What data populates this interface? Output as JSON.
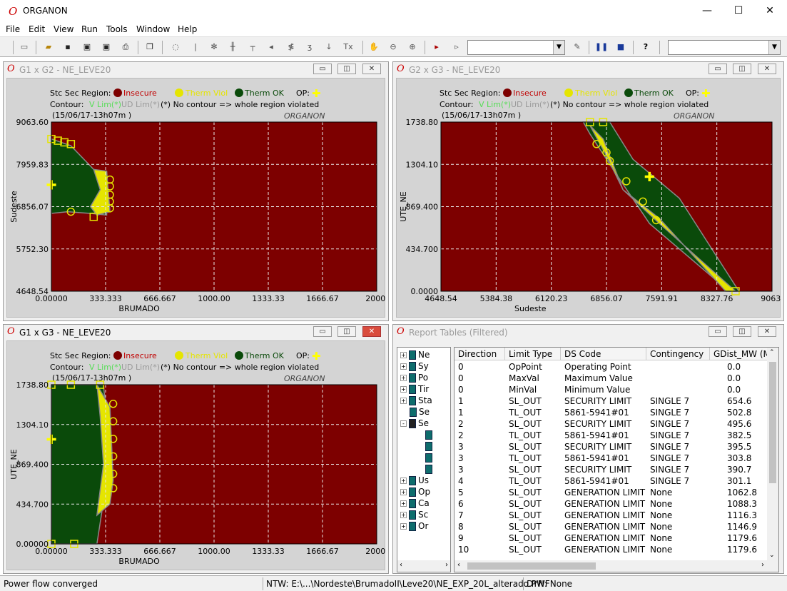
{
  "app": {
    "title": "ORGANON",
    "icon": "organon-logo-icon"
  },
  "window_controls": {
    "minimize": "—",
    "maximize": "☐",
    "close": "✕"
  },
  "menu": [
    "File",
    "Edit",
    "View",
    "Run",
    "Tools",
    "Window",
    "Help"
  ],
  "toolbar": {
    "help": "?"
  },
  "colors": {
    "insecure": "#7d0000",
    "therm_viol": "#e5e500",
    "therm_ok": "#0a4a0a",
    "op": "#ffff00",
    "grid": "#e6e6e6",
    "plot_bg": "#7d0000",
    "vlim": "#55dd55",
    "udlim": "#9a9a9a"
  },
  "legend": {
    "stc": "Stc Sec Region:",
    "insecure": "Insecure",
    "therm_viol": "Therm Viol",
    "therm_ok": "Therm OK",
    "op": "OP:",
    "contour": "Contour:",
    "vlim": "V Lim(*)",
    "udlim": "UD Lim(*)",
    "note": "(*) No contour => whole region violated",
    "time": "(15/06/17-13h07m )",
    "watermark": "ORGANON"
  },
  "charts": [
    {
      "title": "G1 x G2 - NE_LEVE20",
      "title_active": false,
      "xlabel": "BRUMADO",
      "ylabel": "Sudeste",
      "xticks": [
        "0.00000",
        "333.333",
        "666.667",
        "1000.00",
        "1333.33",
        "1666.67",
        "2000."
      ],
      "yticks": [
        "4648.54",
        "5752.30",
        "6856.07",
        "7959.83",
        "9063.60"
      ]
    },
    {
      "title": "G2 x G3 - NE_LEVE20",
      "title_active": false,
      "xlabel": "Sudeste",
      "ylabel": "UTE_NE",
      "xticks": [
        "4648.54",
        "5384.38",
        "6120.23",
        "6856.07",
        "7591.91",
        "8327.76",
        "9063."
      ],
      "yticks": [
        "0.0000",
        "434.700",
        "869.400",
        "1304.10",
        "1738.80"
      ]
    },
    {
      "title": "G1 x G3 - NE_LEVE20",
      "title_active": true,
      "xlabel": "BRUMADO",
      "ylabel": "UTE_NE",
      "xticks": [
        "0.00000",
        "333.333",
        "666.667",
        "1000.00",
        "1333.33",
        "1666.67",
        "2000."
      ],
      "yticks": [
        "0.00000",
        "434.700",
        "869.400",
        "1304.10",
        "1738.80"
      ]
    }
  ],
  "report": {
    "title": "Report Tables (Filtered)",
    "tree": [
      {
        "label": "Ne",
        "exp": "+",
        "indent": 0
      },
      {
        "label": "Sy",
        "exp": "+",
        "indent": 0
      },
      {
        "label": "Po",
        "exp": "+",
        "indent": 0
      },
      {
        "label": "Tir",
        "exp": "+",
        "indent": 0
      },
      {
        "label": "Sta",
        "exp": "+",
        "indent": 0
      },
      {
        "label": "Se",
        "exp": "",
        "indent": 0
      },
      {
        "label": "Se",
        "exp": "-",
        "indent": 0,
        "open": true
      },
      {
        "label": "",
        "exp": "",
        "indent": 1
      },
      {
        "label": "",
        "exp": "",
        "indent": 1
      },
      {
        "label": "",
        "exp": "",
        "indent": 1
      },
      {
        "label": "",
        "exp": "",
        "indent": 1
      },
      {
        "label": "Us",
        "exp": "+",
        "indent": 0
      },
      {
        "label": "Op",
        "exp": "+",
        "indent": 0
      },
      {
        "label": "Ca",
        "exp": "+",
        "indent": 0
      },
      {
        "label": "Sc",
        "exp": "+",
        "indent": 0
      },
      {
        "label": "Or",
        "exp": "+",
        "indent": 0
      }
    ],
    "columns": [
      "Direction",
      "Limit Type",
      "DS Code",
      "Contingency",
      "GDist_MW (M"
    ],
    "rows": [
      [
        "0",
        "OpPoint",
        "Operating Point",
        "",
        "0.0"
      ],
      [
        "0",
        "MaxVal",
        "Maximum Value",
        "",
        "0.0"
      ],
      [
        "0",
        "MinVal",
        "Minimum Value",
        "",
        "0.0"
      ],
      [
        "1",
        "SL_OUT",
        "SECURITY LIMIT",
        "SINGLE   7",
        "654.6"
      ],
      [
        "1",
        "TL_OUT",
        "5861-5941#01",
        "SINGLE   7",
        "502.8"
      ],
      [
        "2",
        "SL_OUT",
        "SECURITY LIMIT",
        "SINGLE   7",
        "495.6"
      ],
      [
        "2",
        "TL_OUT",
        "5861-5941#01",
        "SINGLE   7",
        "382.5"
      ],
      [
        "3",
        "SL_OUT",
        "SECURITY LIMIT",
        "SINGLE   7",
        "395.5"
      ],
      [
        "3",
        "TL_OUT",
        "5861-5941#01",
        "SINGLE   7",
        "303.8"
      ],
      [
        "3",
        "SL_OUT",
        "SECURITY LIMIT",
        "SINGLE   7",
        "390.7"
      ],
      [
        "4",
        "TL_OUT",
        "5861-5941#01",
        "SINGLE   7",
        "301.1"
      ],
      [
        "5",
        "SL_OUT",
        "GENERATION LIMIT",
        "None",
        "1062.8"
      ],
      [
        "6",
        "SL_OUT",
        "GENERATION LIMIT",
        "None",
        "1088.3"
      ],
      [
        "7",
        "SL_OUT",
        "GENERATION LIMIT",
        "None",
        "1116.3"
      ],
      [
        "8",
        "SL_OUT",
        "GENERATION LIMIT",
        "None",
        "1146.9"
      ],
      [
        "9",
        "SL_OUT",
        "GENERATION LIMIT",
        "None",
        "1179.6"
      ],
      [
        "10",
        "SL_OUT",
        "GENERATION LIMIT",
        "None",
        "1179.6"
      ]
    ]
  },
  "status": {
    "left": "Power flow converged",
    "ntw": "NTW: E:\\...\\Nordeste\\BrumadoII\\Leve20\\NE_EXP_20L_alterado.PWF",
    "dyn": "DYN: None"
  }
}
